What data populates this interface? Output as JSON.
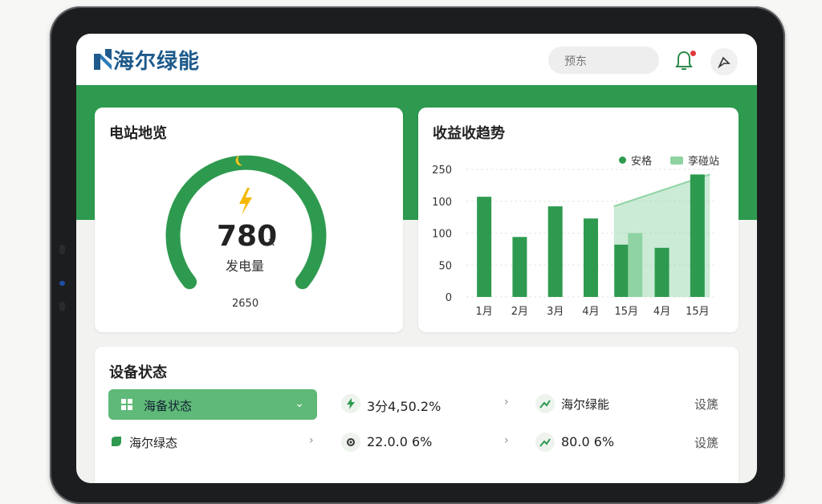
{
  "header": {
    "brand": "海尔绿能",
    "search_placeholder": "预东"
  },
  "station_card": {
    "title": "电站地览",
    "gauge_value": "780",
    "gauge_unit": "x",
    "gauge_label": "发电量",
    "gauge_sub": "2650",
    "gauge_fraction": 1.0
  },
  "revenue_card": {
    "title": "收益收趋势",
    "legend": [
      "安格",
      "孪碰站"
    ]
  },
  "chart_data": {
    "type": "bar",
    "categories": [
      "1月",
      "2月",
      "3月",
      "4月",
      "15月",
      "4月",
      "15月"
    ],
    "yticks": [
      "250",
      "100",
      "100",
      "50",
      "0"
    ],
    "series": [
      {
        "name": "安格",
        "values": [
          157,
          94,
          142,
          123,
          82,
          77,
          192
        ]
      },
      {
        "name": "孪碰站",
        "values": [
          null,
          null,
          null,
          null,
          100,
          null,
          null
        ]
      }
    ],
    "area": {
      "name": "孪碰站",
      "x": [
        4,
        6
      ],
      "y": [
        142,
        192
      ]
    },
    "colors": {
      "primary": "#2e9a4f",
      "secondary": "#8fd3a3"
    },
    "grid": true
  },
  "device_card": {
    "title": "设备状态",
    "pill_label": "海备状态",
    "rows": [
      {
        "label": "海尔绿态"
      }
    ],
    "cells": [
      {
        "value": "3分4,50.2%",
        "icon": "bolt-icon"
      },
      {
        "value": "海尔绿能",
        "icon": "trend-icon"
      },
      {
        "value": "设篪",
        "icon": ""
      },
      {
        "value": "22.0.0 6%",
        "icon": "gear-icon"
      },
      {
        "value": "80.0 6%",
        "icon": "trend-icon"
      },
      {
        "value": "设篪",
        "icon": ""
      }
    ]
  },
  "colors": {
    "brand": "#2e9a4f",
    "logo": "#1e5a8c",
    "accent": "#f5c518"
  }
}
